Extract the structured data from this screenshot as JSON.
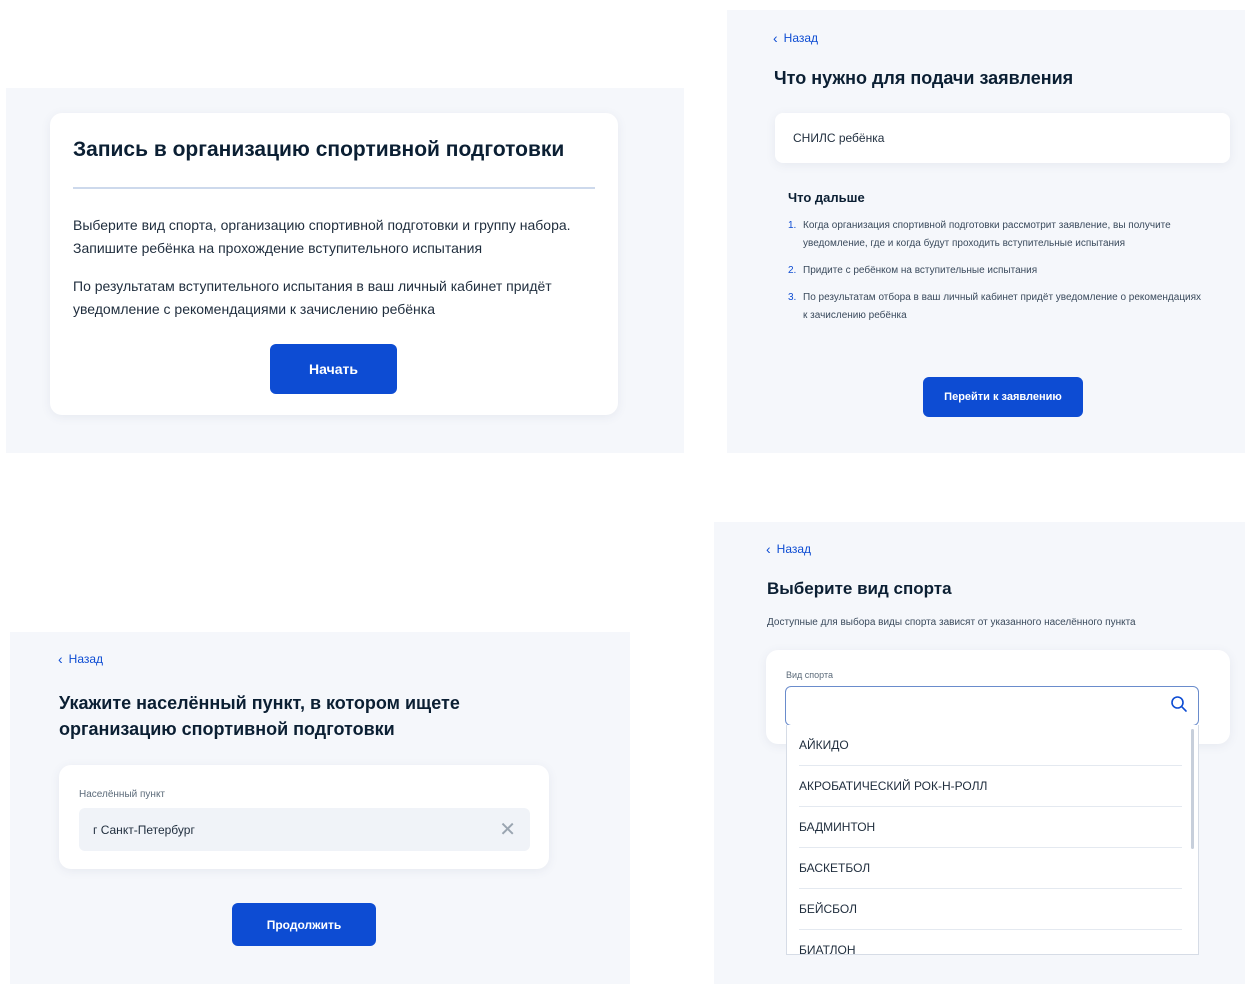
{
  "screen1": {
    "title": "Запись в организацию спортивной подготовки",
    "paragraph1": "Выберите вид спорта, организацию спортивной подготовки и группу набора. Запишите ребёнка на прохождение вступительного испытания",
    "paragraph2": "По результатам вступительного испытания в ваш личный кабинет придёт уведомление с рекомендациями к зачислению ребёнка",
    "start_button": "Начать"
  },
  "screen2": {
    "back_label": "Назад",
    "title": "Что нужно для подачи заявления",
    "requirement": "СНИЛС ребёнка",
    "next_heading": "Что дальше",
    "steps": [
      {
        "num": "1.",
        "text": "Когда организация спортивной подготовки рассмотрит заявление, вы получите уведомление, где и когда будут проходить вступительные испытания"
      },
      {
        "num": "2.",
        "text": "Придите с ребёнком на вступительные испытания"
      },
      {
        "num": "3.",
        "text": "По результатам отбора в ваш личный кабинет придёт уведомление о рекомендациях к зачислению ребёнка"
      }
    ],
    "go_button": "Перейти к заявлению"
  },
  "screen3": {
    "back_label": "Назад",
    "title": "Укажите населённый пункт, в котором ищете организацию спортивной подготовки",
    "field_label": "Населённый пункт",
    "field_value": "г Санкт-Петербург",
    "continue_button": "Продолжить"
  },
  "screen4": {
    "back_label": "Назад",
    "title": "Выберите вид спорта",
    "subtitle": "Доступные для выбора виды спорта зависят от указанного населённого пункта",
    "field_label": "Вид спорта",
    "search_value": "",
    "options": [
      "АЙКИДО",
      "АКРОБАТИЧЕСКИЙ РОК-Н-РОЛЛ",
      "БАДМИНТОН",
      "БАСКЕТБОЛ",
      "БЕЙСБОЛ",
      "БИАТЛОН"
    ]
  },
  "icons": {
    "back": "chevron-left-icon",
    "clear": "close-icon",
    "search": "search-icon"
  },
  "colors": {
    "primary": "#0d4cd3",
    "text": "#0b1f33",
    "panel_bg": "#f5f7fb"
  }
}
